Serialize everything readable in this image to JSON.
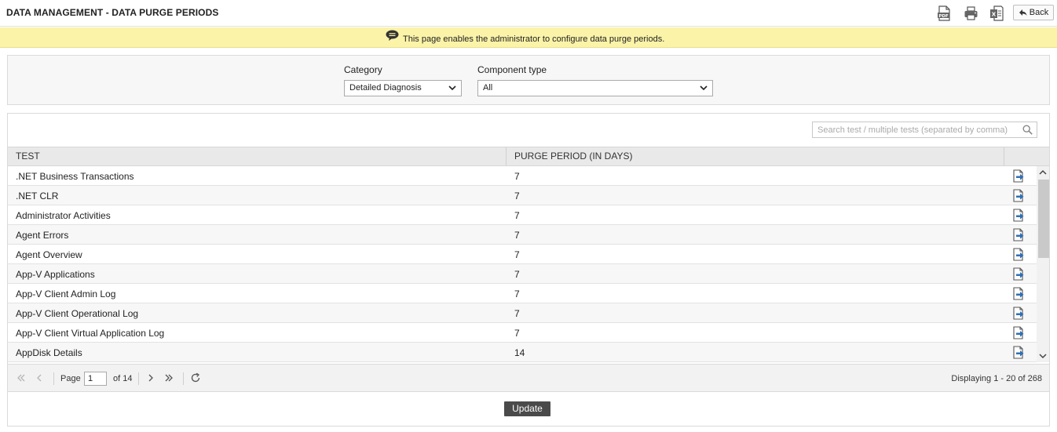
{
  "header": {
    "title": "DATA MANAGEMENT - DATA PURGE PERIODS",
    "back_label": "Back",
    "icons": [
      "pdf-icon",
      "print-icon",
      "excel-icon",
      "back-arrow-icon"
    ]
  },
  "info": {
    "message": "This page enables the administrator to configure data purge periods.",
    "icon": "speech-bubble-icon"
  },
  "filters": {
    "category_label": "Category",
    "category_value": "Detailed Diagnosis",
    "component_label": "Component type",
    "component_value": "All"
  },
  "search": {
    "placeholder": "Search test / multiple tests (separated by comma)"
  },
  "table": {
    "columns": [
      "TEST",
      "PURGE PERIOD (IN DAYS)",
      ""
    ],
    "rows": [
      {
        "test": ".NET Business Transactions",
        "period": "7"
      },
      {
        "test": ".NET CLR",
        "period": "7"
      },
      {
        "test": "Administrator Activities",
        "period": "7"
      },
      {
        "test": "Agent Errors",
        "period": "7"
      },
      {
        "test": "Agent Overview",
        "period": "7"
      },
      {
        "test": "App-V Applications",
        "period": "7"
      },
      {
        "test": "App-V Client Admin Log",
        "period": "7"
      },
      {
        "test": "App-V Client Operational Log",
        "period": "7"
      },
      {
        "test": "App-V Client Virtual Application Log",
        "period": "7"
      },
      {
        "test": "AppDisk Details",
        "period": "14"
      }
    ]
  },
  "pager": {
    "page_label": "Page",
    "current_page": "1",
    "of_label": "of 14",
    "display_text": "Displaying 1 - 20 of 268"
  },
  "actions": {
    "update_label": "Update"
  },
  "colors": {
    "info_bg": "#fbf3a8",
    "header_bg": "#e9e9e9",
    "update_bg": "#4a4a4a",
    "edit_icon_blue": "#2f6fb5"
  }
}
